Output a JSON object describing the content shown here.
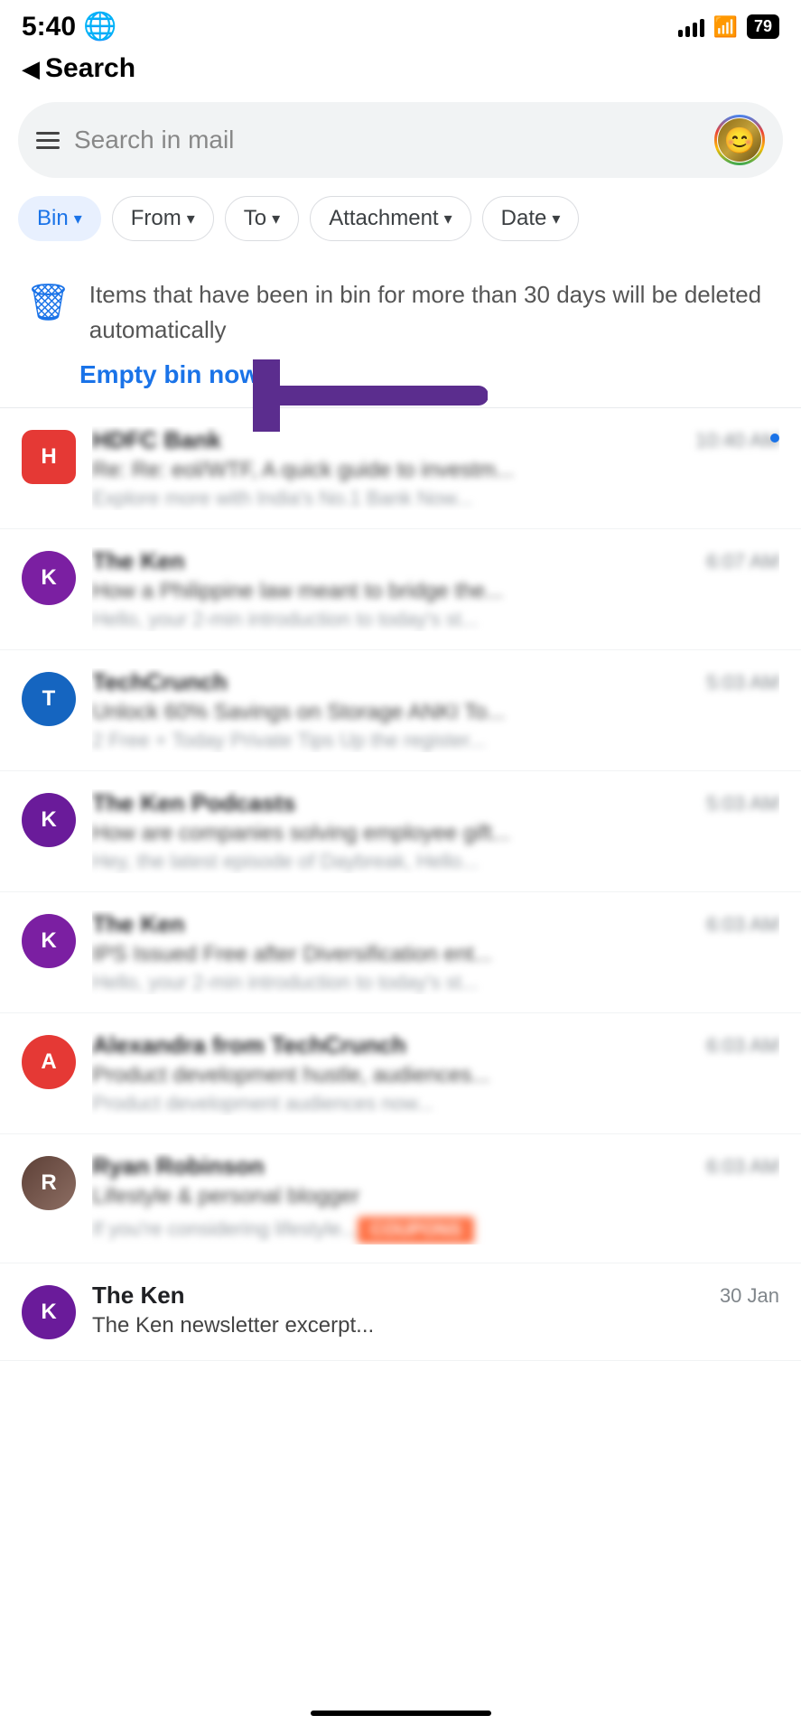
{
  "statusBar": {
    "time": "5:40",
    "globeIcon": "🌐",
    "batteryLevel": "79"
  },
  "backNav": {
    "arrow": "◀",
    "label": "Search"
  },
  "searchBar": {
    "placeholder": "Search in mail"
  },
  "filterChips": [
    {
      "id": "bin",
      "label": "Bin",
      "active": true
    },
    {
      "id": "from",
      "label": "From",
      "active": false
    },
    {
      "id": "to",
      "label": "To",
      "active": false
    },
    {
      "id": "attachment",
      "label": "Attachment",
      "active": false
    },
    {
      "id": "date",
      "label": "Date",
      "active": false
    }
  ],
  "binNotice": {
    "text": "Items that have been in bin for more than 30 days will be deleted automatically",
    "emptyBinLabel": "Empty bin now"
  },
  "emails": [
    {
      "id": 1,
      "senderInitial": "H",
      "avatarClass": "hdfc-avatar",
      "senderName": "HDFC Bank",
      "time": "10:40 AM",
      "subject": "Re: Re: eol/WTF, A quick guide to investm...",
      "preview": "Explore more with India's No.1 Bank Now...",
      "hasUnread": true
    },
    {
      "id": 2,
      "senderInitial": "K",
      "avatarClass": "ken-avatar-purple",
      "senderName": "The Ken",
      "time": "6:07 AM",
      "subject": "How a Philippine law meant to bridge the...",
      "preview": "Hello, your 2-min introduction to today's st...",
      "hasUnread": false
    },
    {
      "id": 3,
      "senderInitial": "T",
      "avatarClass": "techcrunch-avatar-blue",
      "senderName": "TechCrunch",
      "time": "5:03 AM",
      "subject": "Unlock 60% Savings on Storage ANKI To...",
      "preview": "2 Free + Today Private Tips Up the register...",
      "hasUnread": false
    },
    {
      "id": 4,
      "senderInitial": "K",
      "avatarClass": "ken-podcast-purple",
      "senderName": "The Ken Podcasts",
      "time": "5:03 AM",
      "subject": "How are companies solving employee gift...",
      "preview": "Hey, the latest episode of Daybreak, Hello...",
      "hasUnread": false
    },
    {
      "id": 5,
      "senderInitial": "K",
      "avatarClass": "ken2-purple",
      "senderName": "The Ken",
      "time": "6:03 AM",
      "subject": "IPS Issued Free after Diversification ent...",
      "preview": "Hello, your 2-min introduction to today's st...",
      "hasUnread": false
    },
    {
      "id": 6,
      "senderInitial": "A",
      "avatarClass": "alex-red",
      "senderName": "Alexandra from TechCrunch",
      "time": "6:03 AM",
      "subject": "Product development hustle, audiences...",
      "preview": "Product development audiences now...",
      "hasUnread": false,
      "hasCoupon": false
    },
    {
      "id": 7,
      "senderInitial": "R",
      "avatarClass": "ryan-photo",
      "senderName": "Ryan Robinson",
      "time": "6:03 AM",
      "subject": "Lifestyle & personal blogger",
      "preview": "If you're considering lifestyle...",
      "hasUnread": false,
      "hasCoupon": true,
      "couponText": "COUPONS"
    },
    {
      "id": 8,
      "senderInitial": "K",
      "avatarClass": "ken-last-purple",
      "senderName": "The Ken",
      "time": "30 Jan",
      "subject": "The Ken newsletter excerpt...",
      "preview": "",
      "hasUnread": false,
      "isLast": true
    }
  ]
}
